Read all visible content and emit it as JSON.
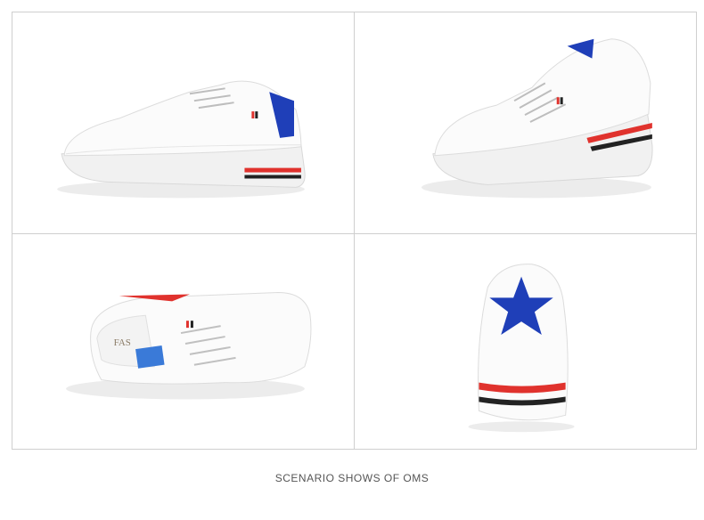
{
  "photos": [
    {
      "id": "side",
      "brand_text": ""
    },
    {
      "id": "three-quarter",
      "brand_text": ""
    },
    {
      "id": "top",
      "insole_text": "FAS"
    },
    {
      "id": "heel",
      "brand_text": ""
    }
  ],
  "caption": "SCENARIO SHOWS OF OMS",
  "colors": {
    "accent_red": "#e0322d",
    "stripe_black": "#222222",
    "star_blue": "#1f3fb8",
    "shoe_white": "#f7f7f7"
  }
}
